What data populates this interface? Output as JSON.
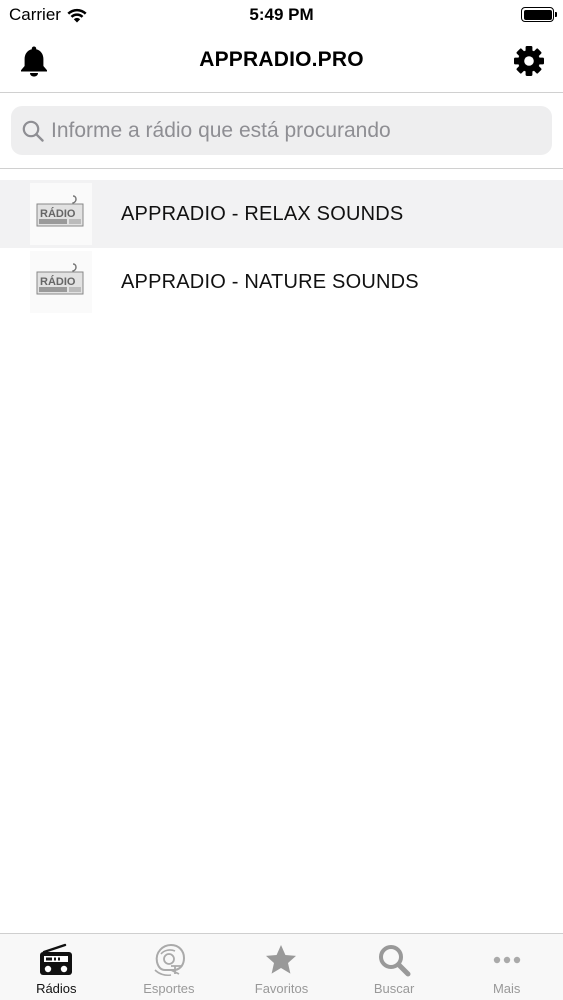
{
  "status_bar": {
    "carrier": "Carrier",
    "time": "5:49 PM"
  },
  "header": {
    "title": "APPRADIO.PRO"
  },
  "search": {
    "placeholder": "Informe a rádio que está procurando"
  },
  "stations": [
    {
      "name": "APPRADIO - RELAX SOUNDS",
      "logo_text": "RÁDIO",
      "selected": true
    },
    {
      "name": "APPRADIO - NATURE SOUNDS",
      "logo_text": "RÁDIO",
      "selected": false
    }
  ],
  "tabs": [
    {
      "label": "Rádios",
      "icon": "radio-icon",
      "active": true
    },
    {
      "label": "Esportes",
      "icon": "football-helmet-icon",
      "active": false
    },
    {
      "label": "Favoritos",
      "icon": "star-icon",
      "active": false
    },
    {
      "label": "Buscar",
      "icon": "search-icon",
      "active": false
    },
    {
      "label": "Mais",
      "icon": "more-icon",
      "active": false
    }
  ],
  "colors": {
    "active_tab": "#111111",
    "inactive_tab": "#999999",
    "search_bg": "#eeeeef",
    "selected_row": "#f2f2f3"
  }
}
